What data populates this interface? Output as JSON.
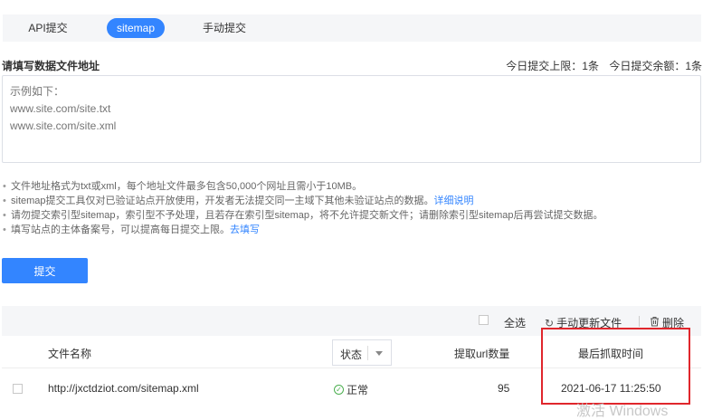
{
  "tabs": [
    {
      "label": "API提交"
    },
    {
      "label": "sitemap"
    },
    {
      "label": "手动提交"
    }
  ],
  "form": {
    "title": "请填写数据文件地址",
    "quota_limit": "今日提交上限：1条",
    "quota_remaining": "今日提交余额：1条",
    "placeholder": "示例如下：\nwww.site.com/site.txt\nwww.site.com/site.xml"
  },
  "notes": [
    {
      "text": "文件地址格式为txt或xml，每个地址文件最多包含50,000个网址且需小于10MB。",
      "link": ""
    },
    {
      "text": "sitemap提交工具仅对已验证站点开放使用，开发者无法提交同一主域下其他未验证站点的数据。",
      "link": "详细说明"
    },
    {
      "text": "请勿提交索引型sitemap，索引型不予处理，且若存在索引型sitemap，将不允许提交新文件；请删除索引型sitemap后再尝试提交数据。",
      "link": ""
    },
    {
      "text": "填写站点的主体备案号，可以提高每日提交上限。",
      "link": "去填写"
    }
  ],
  "submit_label": "提交",
  "toolbar": {
    "select_all": "全选",
    "refresh": "手动更新文件",
    "delete": "删除"
  },
  "table": {
    "headers": {
      "name": "文件名称",
      "status": "状态",
      "count": "提取url数量",
      "time": "最后抓取时间"
    },
    "rows": [
      {
        "url": "http://jxctdziot.com/sitemap.xml",
        "status": "正常",
        "count": "95",
        "time": "2021-06-17 11:25:50"
      }
    ]
  },
  "watermark": "激活 Windows",
  "colors": {
    "accent": "#3385ff",
    "highlight": "#e0262c",
    "ok": "#4caf50"
  }
}
